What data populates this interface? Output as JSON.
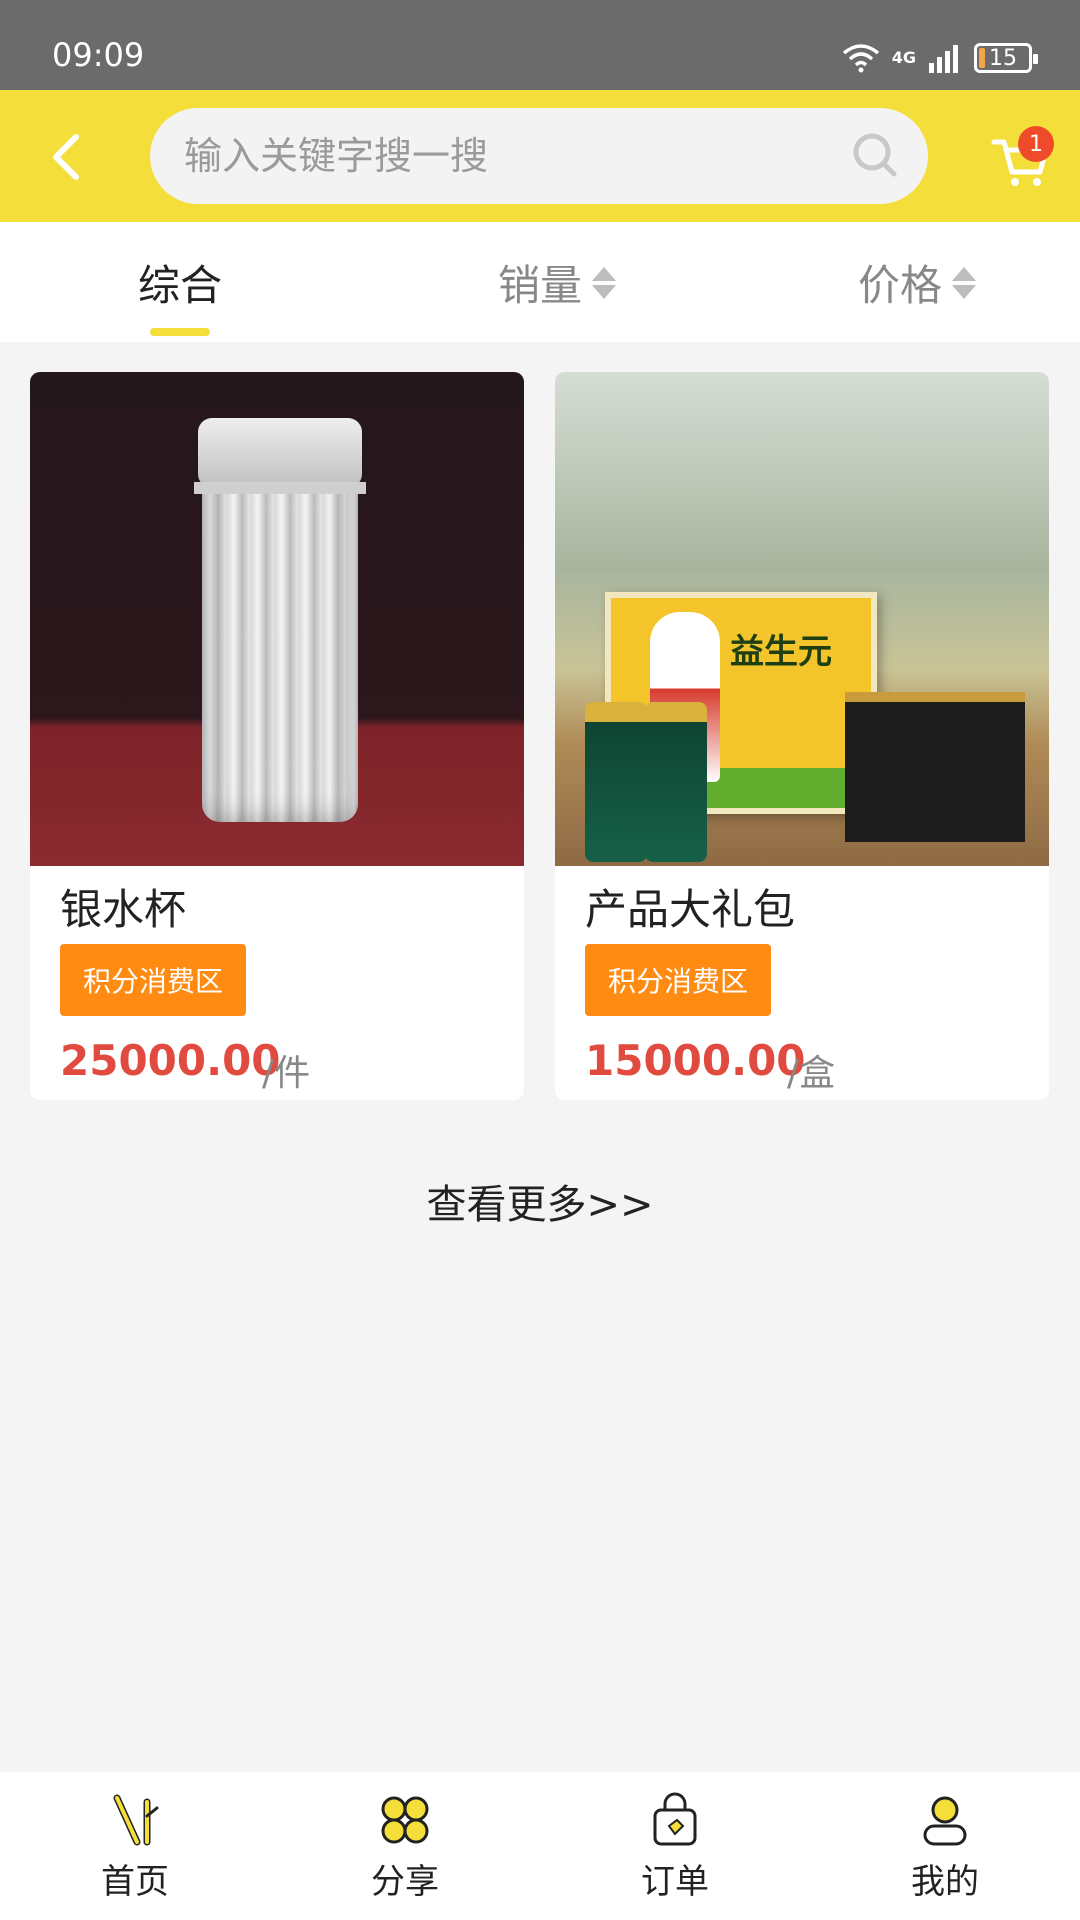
{
  "status_bar": {
    "time": "09:09",
    "network": "4G",
    "battery": "15"
  },
  "header": {
    "search_placeholder": "输入关键字搜一搜",
    "cart_badge": "1"
  },
  "tabs": [
    {
      "label": "综合",
      "active": true
    },
    {
      "label": "销量",
      "sortable": true
    },
    {
      "label": "价格",
      "sortable": true
    }
  ],
  "products": [
    {
      "name": "银水杯",
      "tag": "积分消费区",
      "price": "25000.00",
      "unit": "/件",
      "image": "silver-cup"
    },
    {
      "name": "产品大礼包",
      "tag": "积分消费区",
      "price": "15000.00",
      "unit": "/盒",
      "image": "gift-bundle",
      "image_text": "益生元"
    }
  ],
  "more_link": "查看更多>>",
  "bottom_nav": [
    {
      "label": "首页",
      "icon": "bamboo-home-icon"
    },
    {
      "label": "分享",
      "icon": "clover-share-icon"
    },
    {
      "label": "订单",
      "icon": "bag-order-icon"
    },
    {
      "label": "我的",
      "icon": "user-profile-icon"
    }
  ],
  "colors": {
    "accent": "#f4de3a",
    "price": "#e14b3f",
    "tag": "#ff8b12",
    "badge": "#ef4b2a"
  }
}
